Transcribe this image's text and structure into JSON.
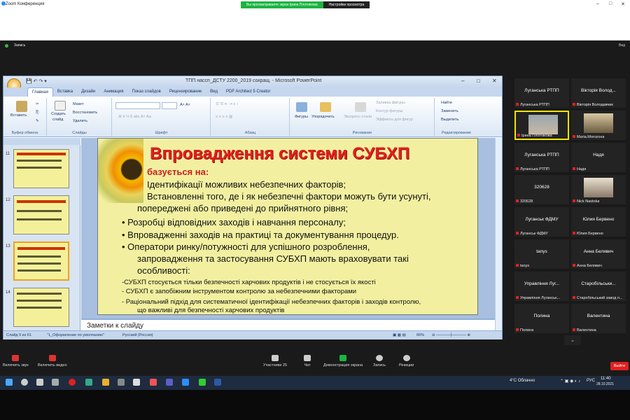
{
  "zoom": {
    "window_title": "Zoom Конференция",
    "banner_viewing": "Вы просматриваете экран Ірина Плотнікова",
    "banner_settings": "Настройки просмотра",
    "recording": "Запись",
    "view_label": "Вид",
    "controls": {
      "audio": "Включить звук",
      "video": "Включить видео",
      "participants": "Участники",
      "participants_count": "25",
      "chat": "Чат",
      "share": "Демонстрация экрана",
      "record": "Запись",
      "reactions": "Реакции",
      "leave": "Выйти"
    }
  },
  "ppt": {
    "title": "ТПП нассп_ДСТУ 2200_2019 сокращ. - Microsoft PowerPoint",
    "tabs": [
      "Главная",
      "Вставка",
      "Дизайн",
      "Анимация",
      "Показ слайдов",
      "Рецензирование",
      "Вид",
      "PDF Architect 5 Creator"
    ],
    "ribbon": {
      "paste": "Вставить",
      "create": "Создать",
      "slide": "слайд",
      "layout": "Макет",
      "reset": "Восстановить",
      "delete": "Удалить",
      "clipboard": "Буфер обмена",
      "slides": "Слайды",
      "font": "Шрифт",
      "paragraph": "Абзац",
      "shapes": "Фигуры",
      "arrange": "Упорядочить",
      "quick_styles": "Экспресс-стили",
      "fill": "Заливка фигуры",
      "outline": "Контур фигуры",
      "effects": "Эффекты для фигур",
      "drawing": "Рисование",
      "find": "Найти",
      "replace": "Заменить",
      "select": "Выделить",
      "editing": "Редактирование"
    },
    "thumb_numbers": [
      "11",
      "12",
      "13",
      "14"
    ],
    "slide": {
      "title": "Впровадження системи СУБХП",
      "subtitle": "базується на:",
      "lines": [
        "Ідентифікації можливих небезпечних факторів;",
        "Встановленні того, де і як небезпечні фактори можуть бути усунуті,",
        "попереджені або приведені до прийнятного рівня;",
        "•   Розробці відповідних заходів і навчання персоналу;",
        "•   Впровадженні заходів на практиці та документування процедур.",
        "•   Оператори ринку/потужності для успішного розроблення,",
        "запровадження та застосування СУБХП мають враховувати такі",
        "особливості:"
      ],
      "small_lines": [
        "-СУБХП стосується тільки безпечності харчових продуктів і не стосується їх якості",
        "- СУБХП є запобіжним інструментом контролю за небезпечними факторами",
        "- Раціональний підхід для систематичної ідентифікації небезпечних факторів і заходів контролю,",
        "що важливі для безпечності харчових продуктів"
      ]
    },
    "notes": "Заметки к слайду",
    "status": {
      "slide": "Слайд 9 из 61",
      "theme": "\"1_Оформление по умолчанию\"",
      "lang": "Русский (Россия)",
      "zoom": "66%"
    }
  },
  "participants": [
    {
      "name": "Луганська РТПП",
      "label": "Луганська РТПП"
    },
    {
      "name": "Вікторія Волод...",
      "label": "Вікторія Володавчик"
    },
    {
      "name": "",
      "label": "Ірина Плотнікова"
    },
    {
      "name": "",
      "label": "Maria.Morozova"
    },
    {
      "name": "Луганська РТПП",
      "label": "Луганська РТПП"
    },
    {
      "name": "Надя",
      "label": "Надя"
    },
    {
      "name": "320628",
      "label": "320628"
    },
    {
      "name": "",
      "label": "Nick Nastoka"
    },
    {
      "name": "Луганськ ФДМУ",
      "label": "Луганськ ФДМУ"
    },
    {
      "name": "Юлия Бервено",
      "label": "Юлия Бервено"
    },
    {
      "name": "tanys",
      "label": "tanys"
    },
    {
      "name": "Анна Белявич",
      "label": "Анна Белявич"
    },
    {
      "name": "Управління Луг...",
      "label": "Управління Луганськ..."
    },
    {
      "name": "Старобільськи...",
      "label": "Старобільський завод п..."
    },
    {
      "name": "Полина",
      "label": "Полина"
    },
    {
      "name": "Валентина",
      "label": "Валентина"
    }
  ],
  "taskbar": {
    "weather": "4°C Облачно",
    "lang": "РУС",
    "time": "11:40",
    "date": "28.10.2021"
  },
  "colors": {
    "slide_bg": "#f2f0a0",
    "title_red": "#e02020",
    "zoom_green": "#1bb441",
    "leave_red": "#e02020"
  }
}
